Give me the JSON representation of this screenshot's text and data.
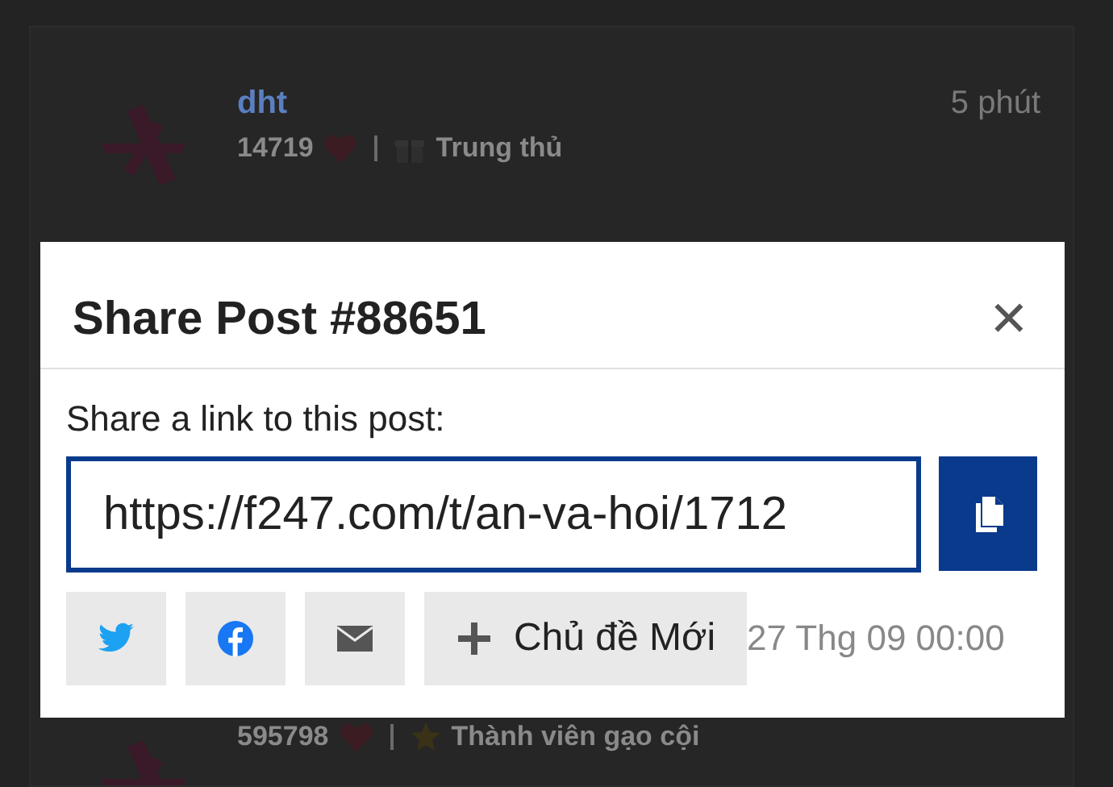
{
  "posts": [
    {
      "author": "dht",
      "time": "5 phút",
      "likes": "14719",
      "badge": "Trung thủ"
    },
    {
      "likes": "595798",
      "badge": "Thành viên gạo cội"
    }
  ],
  "modal": {
    "title": "Share Post #88651",
    "close": "✕",
    "label": "Share a link to this post:",
    "link": "https://f247.com/t/an-va-hoi/1712",
    "share_buttons": [
      {
        "kind": "twitter"
      },
      {
        "kind": "facebook"
      },
      {
        "kind": "email"
      },
      {
        "kind": "new-topic",
        "label": "Chủ đề Mới"
      }
    ],
    "date": "27 Thg 09 00:00"
  }
}
